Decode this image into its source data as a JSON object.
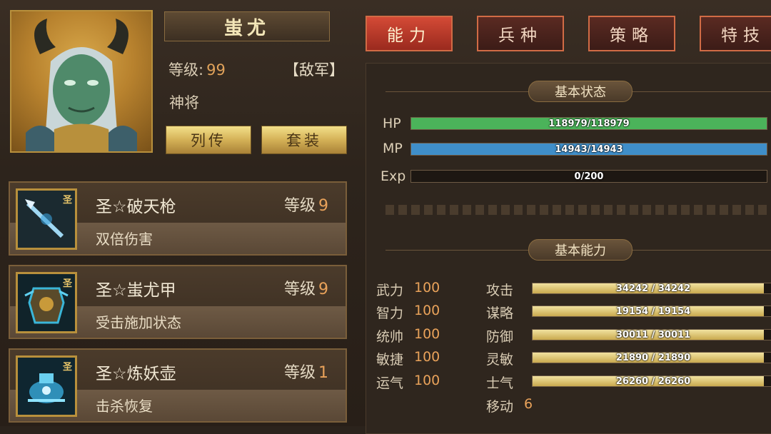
{
  "hero": {
    "name": "蚩尤",
    "level_label": "等级:",
    "level": "99",
    "faction": "【敌军】",
    "rank": "神将",
    "btn_biography": "列传",
    "btn_set": "套装"
  },
  "equipment": [
    {
      "badge": "圣",
      "name": "圣☆破天枪",
      "level_label": "等级",
      "level": "9",
      "desc": "双倍伤害",
      "icon": "spear-icon"
    },
    {
      "badge": "圣",
      "name": "圣☆蚩尤甲",
      "level_label": "等级",
      "level": "9",
      "desc": "受击施加状态",
      "icon": "armor-icon"
    },
    {
      "badge": "圣",
      "name": "圣☆炼妖壶",
      "level_label": "等级",
      "level": "1",
      "desc": "击杀恢复",
      "icon": "pot-icon"
    }
  ],
  "tabs": [
    "能力",
    "兵种",
    "策略",
    "特技"
  ],
  "status": {
    "title": "基本状态",
    "hp": {
      "label": "HP",
      "text": "118979/118979",
      "fraction": 1.0,
      "color": "#4bb35a"
    },
    "mp": {
      "label": "MP",
      "text": "14943/14943",
      "fraction": 1.0,
      "color": "#3f8ec9"
    },
    "exp": {
      "label": "Exp",
      "text": "0/200",
      "fraction": 0.0
    }
  },
  "abilities": {
    "title": "基本能力",
    "base": [
      {
        "name": "武力",
        "value": "100"
      },
      {
        "name": "智力",
        "value": "100"
      },
      {
        "name": "统帅",
        "value": "100"
      },
      {
        "name": "敏捷",
        "value": "100"
      },
      {
        "name": "运气",
        "value": "100"
      }
    ],
    "combat": [
      {
        "name": "攻击",
        "text": "34242 / 34242",
        "fraction": 1.0
      },
      {
        "name": "谋略",
        "text": "19154 / 19154",
        "fraction": 1.0
      },
      {
        "name": "防御",
        "text": "30011 / 30011",
        "fraction": 1.0
      },
      {
        "name": "灵敏",
        "text": "21890 / 21890",
        "fraction": 1.0
      },
      {
        "name": "士气",
        "text": "26260 / 26260",
        "fraction": 1.0
      }
    ],
    "move_label": "移动",
    "move_value": "6"
  }
}
